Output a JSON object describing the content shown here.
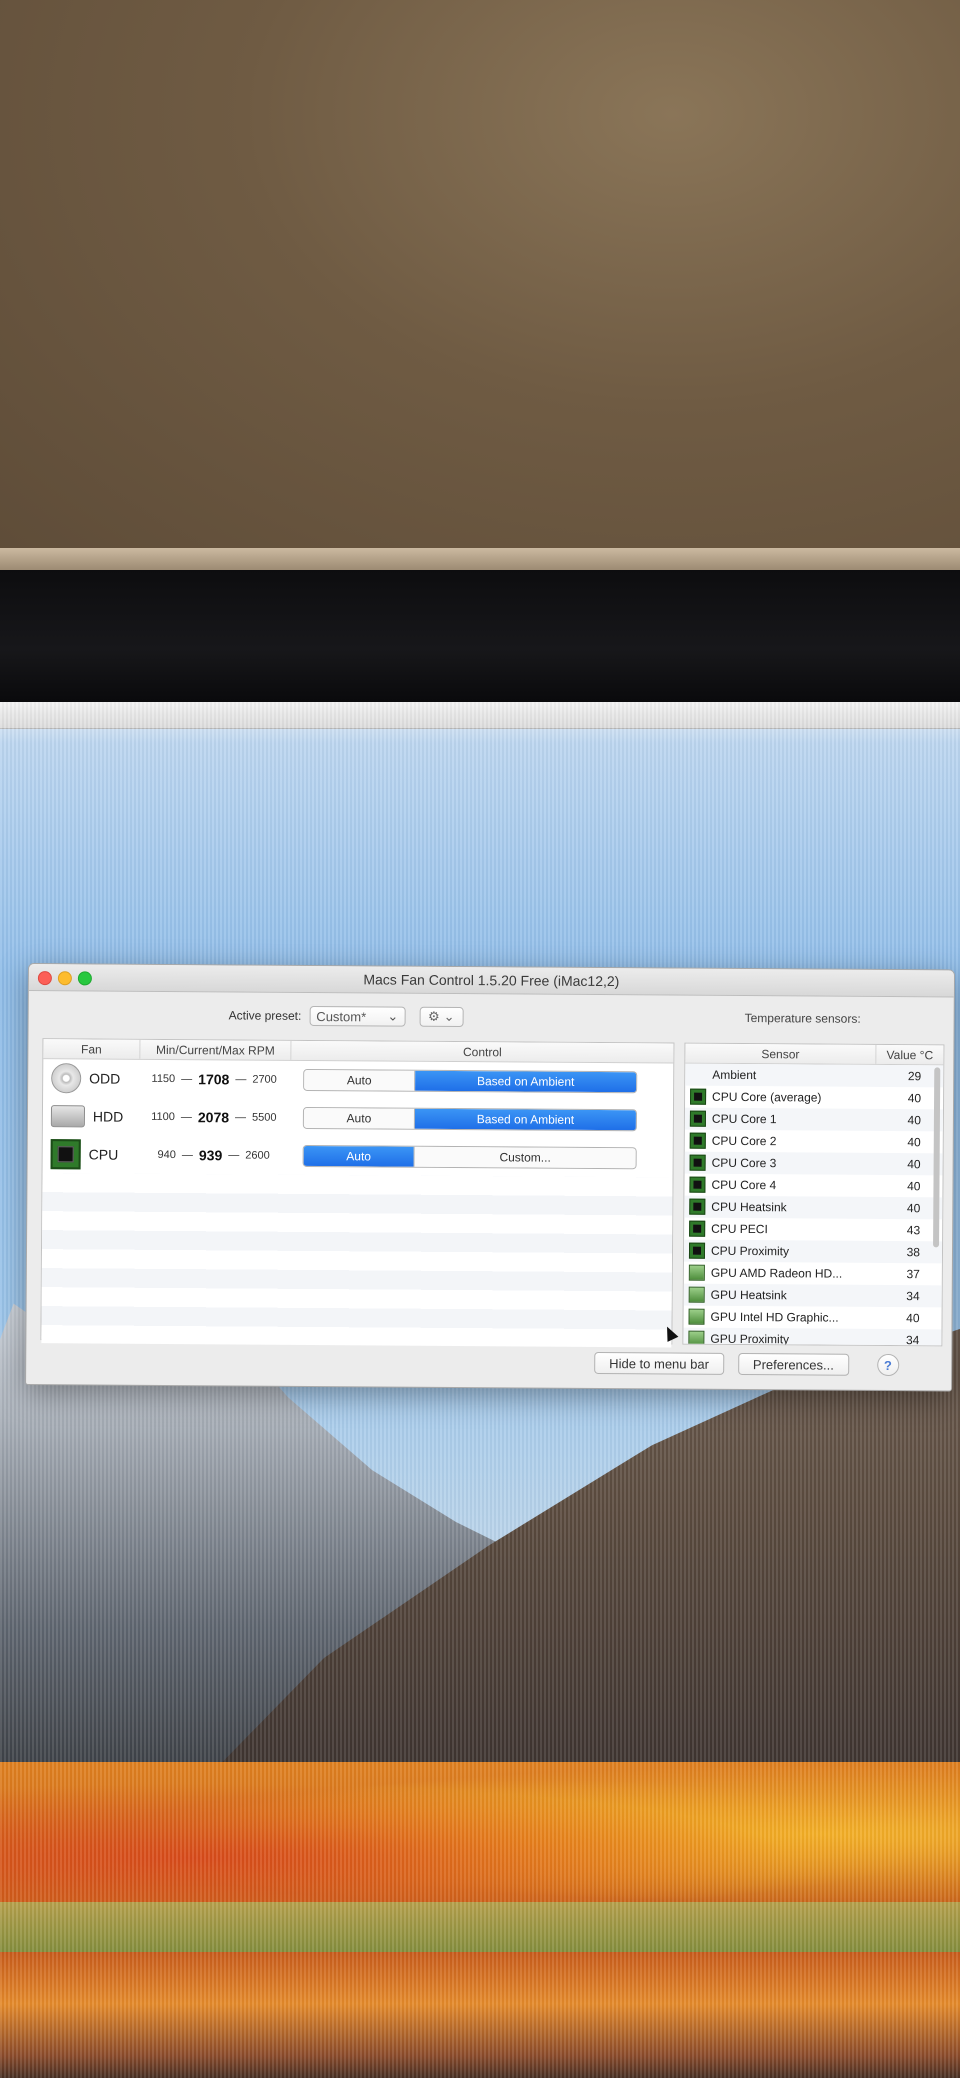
{
  "window": {
    "title": "Macs Fan Control 1.5.20 Free (iMac12,2)"
  },
  "preset": {
    "label": "Active preset:",
    "value": "Custom*",
    "gear_icon": "gear-icon"
  },
  "fans": {
    "headers": {
      "fan": "Fan",
      "rpm": "Min/Current/Max RPM",
      "control": "Control"
    },
    "rows": [
      {
        "name": "ODD",
        "min": "1150",
        "sep1": "—",
        "current": "1708",
        "sep2": "—",
        "max": "2700",
        "opt1": "Auto",
        "opt2": "Based on Ambient",
        "selected": 2,
        "icon": "optical-disc-icon"
      },
      {
        "name": "HDD",
        "min": "1100",
        "sep1": "—",
        "current": "2078",
        "sep2": "—",
        "max": "5500",
        "opt1": "Auto",
        "opt2": "Based on Ambient",
        "selected": 2,
        "icon": "hard-drive-icon"
      },
      {
        "name": "CPU",
        "min": "940",
        "sep1": "—",
        "current": "939",
        "sep2": "—",
        "max": "2600",
        "opt1": "Auto",
        "opt2": "Custom...",
        "selected": 1,
        "icon": "cpu-chip-icon"
      }
    ]
  },
  "sensors": {
    "label": "Temperature sensors:",
    "headers": {
      "sensor": "Sensor",
      "value": "Value °C"
    },
    "rows": [
      {
        "name": "Ambient",
        "value": "29",
        "icon": "none"
      },
      {
        "name": "CPU Core (average)",
        "value": "40",
        "icon": "chip"
      },
      {
        "name": "CPU Core 1",
        "value": "40",
        "icon": "chip"
      },
      {
        "name": "CPU Core 2",
        "value": "40",
        "icon": "chip"
      },
      {
        "name": "CPU Core 3",
        "value": "40",
        "icon": "chip"
      },
      {
        "name": "CPU Core 4",
        "value": "40",
        "icon": "chip"
      },
      {
        "name": "CPU Heatsink",
        "value": "40",
        "icon": "chip"
      },
      {
        "name": "CPU PECI",
        "value": "43",
        "icon": "chip"
      },
      {
        "name": "CPU Proximity",
        "value": "38",
        "icon": "chip"
      },
      {
        "name": "GPU AMD Radeon HD...",
        "value": "37",
        "icon": "gpu"
      },
      {
        "name": "GPU Heatsink",
        "value": "34",
        "icon": "gpu"
      },
      {
        "name": "GPU Intel HD Graphic...",
        "value": "40",
        "icon": "gpu"
      },
      {
        "name": "GPU Proximity",
        "value": "34",
        "icon": "gpu"
      }
    ]
  },
  "buttons": {
    "hide": "Hide to menu bar",
    "preferences": "Preferences...",
    "help": "?"
  },
  "colors": {
    "selected_segment": "#1f6fe8",
    "chip_green": "#2f7a2a"
  }
}
